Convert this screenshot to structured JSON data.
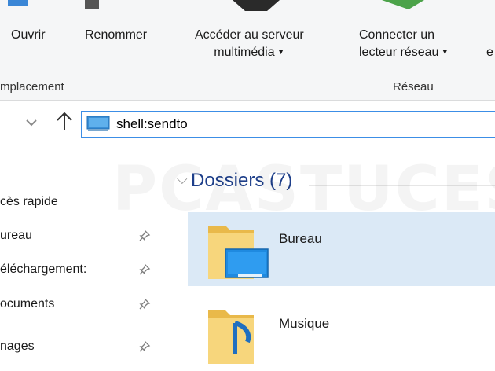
{
  "ribbon": {
    "buttons": [
      {
        "label": "Ouvrir",
        "icon": "open-icon"
      },
      {
        "label": "Renommer",
        "icon": "rename-icon"
      },
      {
        "line1": "Accéder au serveur",
        "line2": "multimédia",
        "icon": "media-server-icon"
      },
      {
        "line1": "Connecter un",
        "line2": "lecteur réseau",
        "icon": "map-drive-icon"
      }
    ],
    "truncated_next": "e",
    "groups": [
      {
        "label": "mplacement"
      },
      {
        "label": "Réseau"
      }
    ]
  },
  "address_bar": {
    "value": "shell:sendto",
    "icon": "desktop-icon"
  },
  "navigation": {
    "items": [
      {
        "label": "cès rapide",
        "pinned": false
      },
      {
        "label": "ureau",
        "pinned": true
      },
      {
        "label": "éléchargement:",
        "pinned": true
      },
      {
        "label": "ocuments",
        "pinned": true
      },
      {
        "label": "nages",
        "pinned": true
      }
    ]
  },
  "content": {
    "section_title": "Dossiers (7)",
    "folders": [
      {
        "name": "Bureau",
        "icon": "desktop-folder-icon",
        "selected": true
      },
      {
        "name": "Musique",
        "icon": "music-folder-icon",
        "selected": false
      }
    ]
  },
  "watermark": "PCASTUCES",
  "colors": {
    "accent": "#3c8ee6",
    "selection": "#dbe9f6",
    "header_blue": "#1e3f8a",
    "folder_yellow": "#f7d67c"
  }
}
